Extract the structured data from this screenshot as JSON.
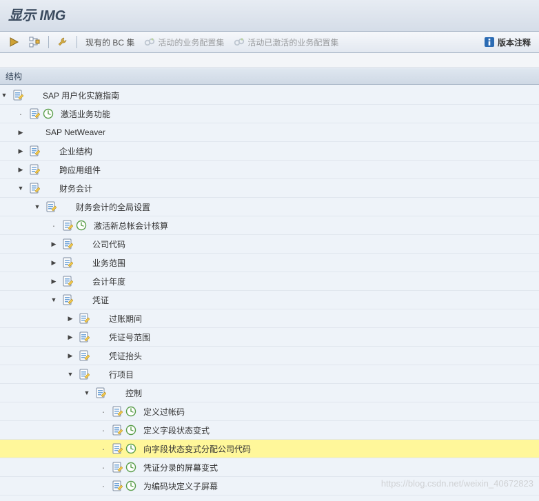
{
  "title": "显示 IMG",
  "toolbar": {
    "existing_bc_set": "现有的 BC 集",
    "activity_bc_set": "活动的业务配置集",
    "activated_bc_set": "活动已激活的业务配置集",
    "version_notes": "版本注释"
  },
  "panel_header": "结构",
  "tree": [
    {
      "level": 0,
      "caret": "open",
      "icons": [
        "doc"
      ],
      "label": "SAP 用户化实施指南",
      "gap": true
    },
    {
      "level": 1,
      "caret": "leaf",
      "icons": [
        "doc",
        "clock"
      ],
      "label": "激活业务功能"
    },
    {
      "level": 1,
      "caret": "closed",
      "icons": [],
      "label": "SAP NetWeaver",
      "gap": true
    },
    {
      "level": 1,
      "caret": "closed",
      "icons": [
        "doc"
      ],
      "label": "企业结构",
      "gap": true
    },
    {
      "level": 1,
      "caret": "closed",
      "icons": [
        "doc"
      ],
      "label": "跨应用组件",
      "gap": true
    },
    {
      "level": 1,
      "caret": "open",
      "icons": [
        "doc"
      ],
      "label": "财务会计",
      "gap": true
    },
    {
      "level": 2,
      "caret": "open",
      "icons": [
        "doc"
      ],
      "label": "财务会计的全局设置",
      "gap": true
    },
    {
      "level": 3,
      "caret": "leaf",
      "icons": [
        "doc",
        "clock"
      ],
      "label": "激活新总帐会计核算"
    },
    {
      "level": 3,
      "caret": "closed",
      "icons": [
        "doc"
      ],
      "label": "公司代码",
      "gap": true
    },
    {
      "level": 3,
      "caret": "closed",
      "icons": [
        "doc"
      ],
      "label": "业务范围",
      "gap": true
    },
    {
      "level": 3,
      "caret": "closed",
      "icons": [
        "doc"
      ],
      "label": "会计年度",
      "gap": true
    },
    {
      "level": 3,
      "caret": "open",
      "icons": [
        "doc"
      ],
      "label": "凭证",
      "gap": true
    },
    {
      "level": 4,
      "caret": "closed",
      "icons": [
        "doc"
      ],
      "label": "过账期间",
      "gap": true
    },
    {
      "level": 4,
      "caret": "closed",
      "icons": [
        "doc"
      ],
      "label": "凭证号范围",
      "gap": true
    },
    {
      "level": 4,
      "caret": "closed",
      "icons": [
        "doc"
      ],
      "label": "凭证抬头",
      "gap": true
    },
    {
      "level": 4,
      "caret": "open",
      "icons": [
        "doc"
      ],
      "label": "行项目",
      "gap": true
    },
    {
      "level": 5,
      "caret": "open",
      "icons": [
        "doc"
      ],
      "label": "控制",
      "gap": true
    },
    {
      "level": 6,
      "caret": "leaf",
      "icons": [
        "doc",
        "clock"
      ],
      "label": "定义过帐码"
    },
    {
      "level": 6,
      "caret": "leaf",
      "icons": [
        "doc",
        "clock"
      ],
      "label": "定义字段状态变式"
    },
    {
      "level": 6,
      "caret": "leaf",
      "icons": [
        "doc",
        "clock"
      ],
      "label": "向字段状态变式分配公司代码",
      "selected": true
    },
    {
      "level": 6,
      "caret": "leaf",
      "icons": [
        "doc",
        "clock"
      ],
      "label": "凭证分录的屏幕变式"
    },
    {
      "level": 6,
      "caret": "leaf",
      "icons": [
        "doc",
        "clock"
      ],
      "label": "为编码块定义子屏幕"
    }
  ],
  "watermark": "https://blog.csdn.net/weixin_40672823"
}
